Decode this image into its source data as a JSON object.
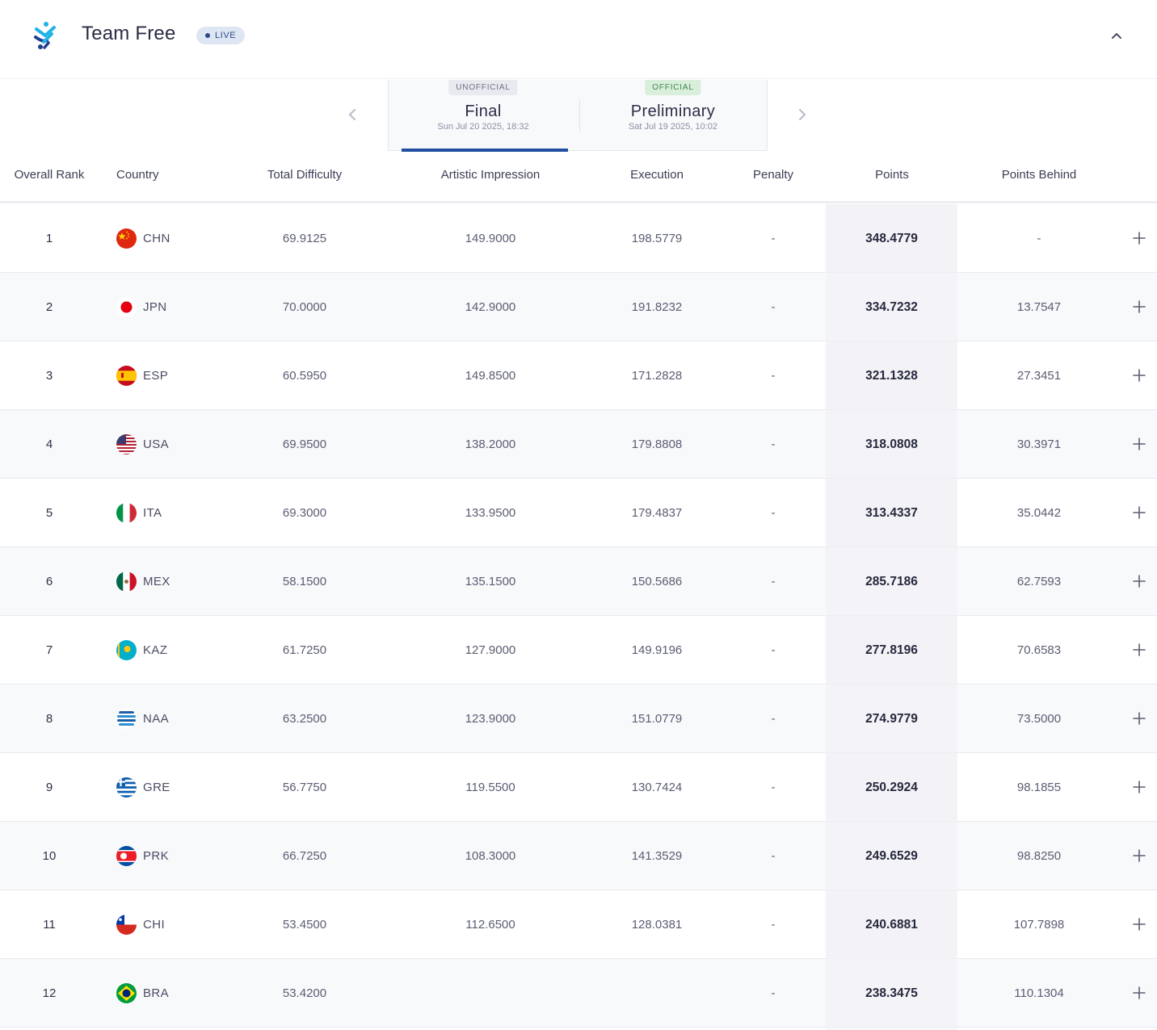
{
  "header": {
    "title": "Team Free",
    "live_label": "LIVE"
  },
  "rounds": [
    {
      "tag": "UNOFFICIAL",
      "name": "Final",
      "date": "Sun Jul 20 2025, 18:32",
      "active": true
    },
    {
      "tag": "OFFICIAL",
      "name": "Preliminary",
      "date": "Sat Jul 19 2025, 10:02",
      "active": false
    }
  ],
  "columns": {
    "rank": "Overall Rank",
    "country": "Country",
    "difficulty": "Total Difficulty",
    "artistic": "Artistic Impression",
    "execution": "Execution",
    "penalty": "Penalty",
    "points": "Points",
    "behind": "Points Behind"
  },
  "rows": [
    {
      "rank": "1",
      "code": "CHN",
      "difficulty": "69.9125",
      "artistic": "149.9000",
      "execution": "198.5779",
      "penalty": "-",
      "points": "348.4779",
      "behind": "-"
    },
    {
      "rank": "2",
      "code": "JPN",
      "difficulty": "70.0000",
      "artistic": "142.9000",
      "execution": "191.8232",
      "penalty": "-",
      "points": "334.7232",
      "behind": "13.7547"
    },
    {
      "rank": "3",
      "code": "ESP",
      "difficulty": "60.5950",
      "artistic": "149.8500",
      "execution": "171.2828",
      "penalty": "-",
      "points": "321.1328",
      "behind": "27.3451"
    },
    {
      "rank": "4",
      "code": "USA",
      "difficulty": "69.9500",
      "artistic": "138.2000",
      "execution": "179.8808",
      "penalty": "-",
      "points": "318.0808",
      "behind": "30.3971"
    },
    {
      "rank": "5",
      "code": "ITA",
      "difficulty": "69.3000",
      "artistic": "133.9500",
      "execution": "179.4837",
      "penalty": "-",
      "points": "313.4337",
      "behind": "35.0442"
    },
    {
      "rank": "6",
      "code": "MEX",
      "difficulty": "58.1500",
      "artistic": "135.1500",
      "execution": "150.5686",
      "penalty": "-",
      "points": "285.7186",
      "behind": "62.7593"
    },
    {
      "rank": "7",
      "code": "KAZ",
      "difficulty": "61.7250",
      "artistic": "127.9000",
      "execution": "149.9196",
      "penalty": "-",
      "points": "277.8196",
      "behind": "70.6583"
    },
    {
      "rank": "8",
      "code": "NAA",
      "difficulty": "63.2500",
      "artistic": "123.9000",
      "execution": "151.0779",
      "penalty": "-",
      "points": "274.9779",
      "behind": "73.5000"
    },
    {
      "rank": "9",
      "code": "GRE",
      "difficulty": "56.7750",
      "artistic": "119.5500",
      "execution": "130.7424",
      "penalty": "-",
      "points": "250.2924",
      "behind": "98.1855"
    },
    {
      "rank": "10",
      "code": "PRK",
      "difficulty": "66.7250",
      "artistic": "108.3000",
      "execution": "141.3529",
      "penalty": "-",
      "points": "249.6529",
      "behind": "98.8250"
    },
    {
      "rank": "11",
      "code": "CHI",
      "difficulty": "53.4500",
      "artistic": "112.6500",
      "execution": "128.0381",
      "penalty": "-",
      "points": "240.6881",
      "behind": "107.7898"
    },
    {
      "rank": "12",
      "code": "BRA",
      "difficulty": "53.4200",
      "artistic": "",
      "execution": "",
      "penalty": "-",
      "points": "238.3475",
      "behind": "110.1304"
    }
  ],
  "icons": {
    "logo": "artistic-swimming-icon",
    "collapse": "chevron-up-icon",
    "prev": "chevron-left-icon",
    "next": "chevron-right-icon",
    "expand": "plus-icon"
  },
  "colors": {
    "accent": "#1f4fa0",
    "live_bg": "#dfe6f3",
    "official_bg": "#d9eedb",
    "unofficial_bg": "#e8eaef"
  }
}
